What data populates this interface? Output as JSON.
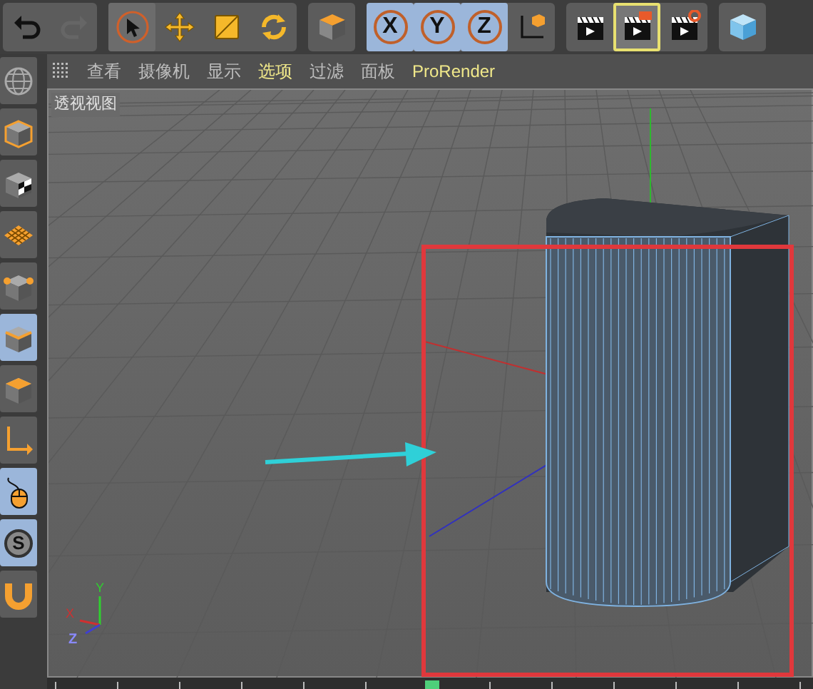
{
  "toolbar": {
    "groups": [
      {
        "items": [
          {
            "kind": "undo",
            "disabled": false
          },
          {
            "kind": "redo",
            "disabled": true
          }
        ]
      },
      {
        "items": [
          {
            "kind": "select",
            "selected": true
          },
          {
            "kind": "move",
            "selected": false
          },
          {
            "kind": "scale",
            "selected": false
          },
          {
            "kind": "rotate",
            "selected": false
          }
        ]
      },
      {
        "items": [
          {
            "kind": "cube-object",
            "selected": false
          }
        ]
      },
      {
        "items": [
          {
            "kind": "axis",
            "label": "X",
            "selected": true
          },
          {
            "kind": "axis",
            "label": "Y",
            "selected": true
          },
          {
            "kind": "axis",
            "label": "Z",
            "selected": true
          },
          {
            "kind": "coords",
            "selected": false
          }
        ]
      },
      {
        "items": [
          {
            "kind": "render-view",
            "selected": false
          },
          {
            "kind": "render-picture",
            "selected": true
          },
          {
            "kind": "render-settings",
            "selected": false
          }
        ]
      },
      {
        "items": [
          {
            "kind": "cube",
            "selected": false
          }
        ]
      }
    ]
  },
  "menu": [
    {
      "label": "查看",
      "highlighted": false
    },
    {
      "label": "摄像机",
      "highlighted": false
    },
    {
      "label": "显示",
      "highlighted": false
    },
    {
      "label": "选项",
      "highlighted": true
    },
    {
      "label": "过滤",
      "highlighted": false
    },
    {
      "label": "面板",
      "highlighted": false
    },
    {
      "label": "ProRender",
      "highlighted": true
    }
  ],
  "left_toolbar": [
    {
      "kind": "globe",
      "selected": false
    },
    {
      "kind": "model",
      "selected": false
    },
    {
      "kind": "texture",
      "selected": false
    },
    {
      "kind": "workplane",
      "selected": false
    },
    {
      "kind": "points",
      "selected": false
    },
    {
      "kind": "edges",
      "selected": true
    },
    {
      "kind": "polygons",
      "selected": false
    },
    {
      "kind": "axis-mode",
      "selected": false
    },
    {
      "kind": "tweak",
      "selected": true
    },
    {
      "kind": "snap",
      "label": "S",
      "selected": true
    },
    {
      "kind": "magnet",
      "selected": false
    }
  ],
  "viewport": {
    "title": "透视视图",
    "gizmo": {
      "x": "X",
      "y": "Y",
      "z": "Z"
    }
  }
}
